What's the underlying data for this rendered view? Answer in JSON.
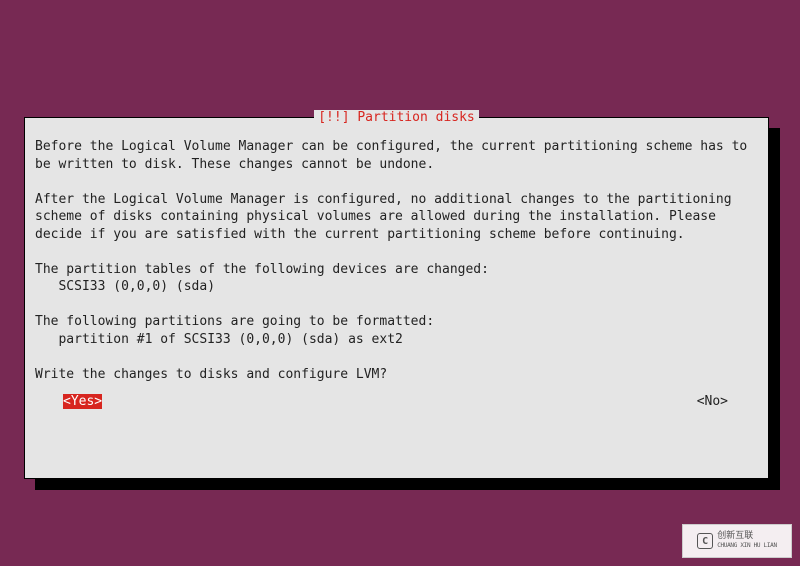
{
  "dialog": {
    "title": " [!!] Partition disks ",
    "para1": "Before the Logical Volume Manager can be configured, the current partitioning scheme has to be written to disk. These changes cannot be undone.",
    "para2": "After the Logical Volume Manager is configured, no additional changes to the partitioning scheme of disks containing physical volumes are allowed during the installation. Please decide if you are satisfied with the current partitioning scheme before continuing.",
    "tables_header": "The partition tables of the following devices are changed:",
    "tables_item": "   SCSI33 (0,0,0) (sda)",
    "format_header": "The following partitions are going to be formatted:",
    "format_item": "   partition #1 of SCSI33 (0,0,0) (sda) as ext2",
    "question": "Write the changes to disks and configure LVM?",
    "yes_label": "<Yes>",
    "no_label": "<No>"
  },
  "watermark": {
    "brand_cn": "创新互联",
    "brand_en": "CHUANG XIN HU LIAN"
  }
}
